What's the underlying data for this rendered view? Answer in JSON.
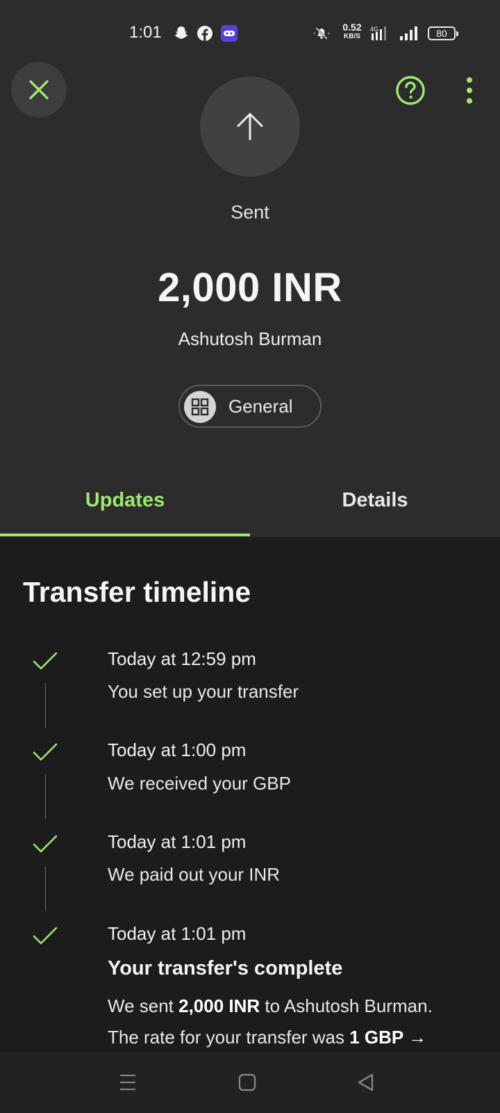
{
  "status_bar": {
    "time": "1:01",
    "net_speed": "0.52",
    "net_unit": "KB/S",
    "network_type": "4G",
    "battery": "80",
    "icons": [
      "snapchat-icon",
      "facebook-icon",
      "game-controller-icon",
      "mute-icon",
      "signal-icon",
      "battery-icon"
    ]
  },
  "header": {
    "close_icon": "close-icon",
    "help_icon": "help-icon",
    "more_icon": "more-options-icon"
  },
  "transfer": {
    "direction_icon": "arrow-up-icon",
    "status": "Sent",
    "amount": "2,000 INR",
    "recipient": "Ashutosh Burman",
    "category": "General",
    "category_icon": "grid-icon"
  },
  "tabs": [
    {
      "label": "Updates",
      "active": true
    },
    {
      "label": "Details",
      "active": false
    }
  ],
  "timeline": {
    "title": "Transfer timeline",
    "events": [
      {
        "time": "Today at 12:59 pm",
        "description": "You set up your transfer"
      },
      {
        "time": "Today at 1:00 pm",
        "description": "We received your GBP"
      },
      {
        "time": "Today at 1:01 pm",
        "description": "We paid out your INR"
      },
      {
        "time": "Today at 1:01 pm",
        "title": "Your transfer's complete"
      }
    ],
    "complete_line1": {
      "prefix": "We sent ",
      "amount": "2,000 INR",
      "suffix": " to Ashutosh Burman."
    },
    "complete_line2": {
      "prefix": "The rate for your transfer was ",
      "rate": "1 GBP →"
    }
  },
  "colors": {
    "accent": "#9fe870",
    "header_bg": "#2b2c2b",
    "body_bg": "#1b1c1b"
  },
  "nav_bar": {
    "icons": [
      "menu-icon",
      "home-icon",
      "back-icon"
    ]
  }
}
